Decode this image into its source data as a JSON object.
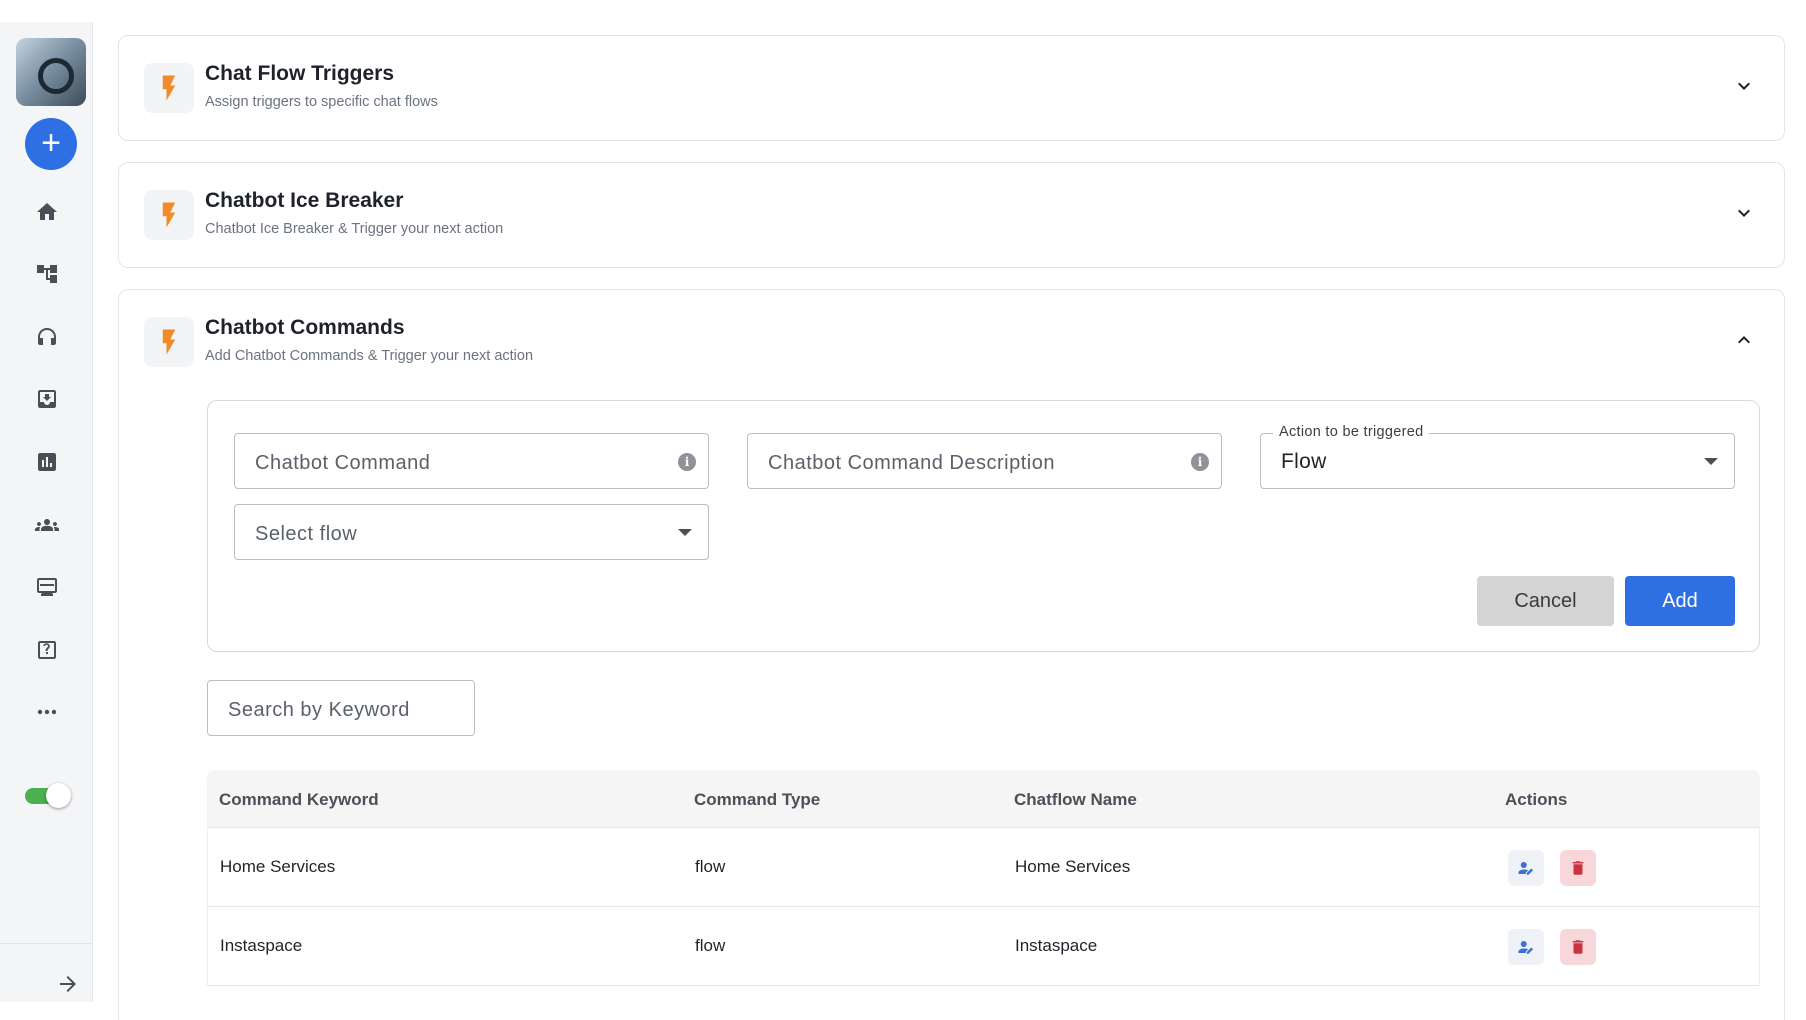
{
  "sidebar": {
    "logo_alt": "app logo",
    "add_label": "+",
    "nav_items": [
      {
        "name": "home",
        "icon": "home-icon"
      },
      {
        "name": "flows",
        "icon": "flow-tree-icon"
      },
      {
        "name": "live-chat",
        "icon": "headset-icon"
      },
      {
        "name": "inbox",
        "icon": "inbox-icon"
      },
      {
        "name": "analytics",
        "icon": "chart-icon"
      },
      {
        "name": "audience",
        "icon": "users-icon"
      },
      {
        "name": "broadcast",
        "icon": "display-icon"
      },
      {
        "name": "help",
        "icon": "help-icon"
      },
      {
        "name": "more",
        "icon": "more-icon"
      }
    ],
    "toggle_on": true,
    "toggle_color": "#4caf50"
  },
  "sections": {
    "triggers": {
      "title": "Chat Flow Triggers",
      "subtitle": "Assign triggers to specific chat flows"
    },
    "icebreaker": {
      "title": "Chatbot Ice Breaker",
      "subtitle": "Chatbot Ice Breaker & Trigger your next action"
    },
    "commands": {
      "title": "Chatbot Commands",
      "subtitle": "Add Chatbot Commands & Trigger your next action"
    }
  },
  "form": {
    "command_placeholder": "Chatbot Command",
    "description_placeholder": "Chatbot Command Description",
    "action_label": "Action to be triggered",
    "action_value": "Flow",
    "flow_placeholder": "Select flow",
    "cancel_label": "Cancel",
    "add_label": "Add"
  },
  "search": {
    "placeholder": "Search by Keyword"
  },
  "table": {
    "headers": [
      "Command Keyword",
      "Command Type",
      "Chatflow Name",
      "Actions"
    ],
    "rows": [
      {
        "keyword": "Home Services",
        "type": "flow",
        "chatflow": "Home Services"
      },
      {
        "keyword": "Instaspace",
        "type": "flow",
        "chatflow": "Instaspace"
      }
    ]
  },
  "colors": {
    "accent": "#2f6fe4",
    "bolt": "#f28a2b",
    "delete": "#c9343e"
  }
}
